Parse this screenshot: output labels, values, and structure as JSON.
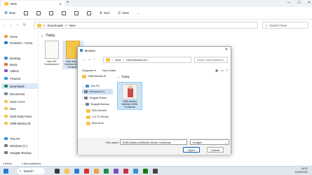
{
  "window": {
    "tab_title": "New"
  },
  "commands": {
    "new": "New",
    "sort": "Sort",
    "view": "View",
    "more": "..."
  },
  "address": {
    "parts": [
      "Downloads",
      "New"
    ],
    "sep": ">"
  },
  "search": {
    "placeholder": "Search New"
  },
  "sidebar": {
    "items": [
      {
        "label": "Home"
      },
      {
        "label": "OneDrive - Perso"
      },
      {
        "label": "Desktop"
      },
      {
        "label": "Music"
      },
      {
        "label": "Videos"
      },
      {
        "label": "Pictures"
      },
      {
        "label": "Downloads"
      },
      {
        "label": "Documents"
      },
      {
        "label": "2022-AAAA"
      },
      {
        "label": "New"
      },
      {
        "label": "2020-Dolly Parto"
      },
      {
        "label": "1998-Martina M"
      },
      {
        "label": "This PC"
      },
      {
        "label": "Windows (C:)"
      },
      {
        "label": "Seagate Backup"
      }
    ]
  },
  "content": {
    "group": "Today",
    "files": [
      {
        "line1": "New HP",
        "line2": "Screenshot 1"
      },
      {
        "line1": "1998-Martina",
        "line2": "McBride-White",
        "line3": "Christmas"
      }
    ]
  },
  "status": {
    "count": "2 items",
    "selected": "1 item selected"
  },
  "dialog": {
    "title": "Browse",
    "address": [
      "New",
      "1998-Martina Mc..."
    ],
    "search_placeholder": "Search 1998-Martina M...",
    "organize": "Organize ▾",
    "new_folder": "New folder",
    "tree": [
      {
        "label": "1998-Martina M"
      },
      {
        "label": "This PC"
      },
      {
        "label": "Windows (C:)"
      },
      {
        "label": "Seagate Backu"
      },
      {
        "label": "Seagate Backup"
      },
      {
        "label": "0001-Movies"
      },
      {
        "label": "1-A-TV Shows"
      },
      {
        "label": "Miss Docs"
      }
    ],
    "group": "Today",
    "file": {
      "line1": "1998-Martina",
      "line2": "McBride-White",
      "line3": "Christmas"
    },
    "filename_label": "File name:",
    "filename_value": "1998-Martina McBride-White Christmas",
    "filetype": "Images",
    "open": "Open",
    "cancel": "Cancel"
  },
  "taskbar": {
    "search": "Search",
    "time": "18:37",
    "date": "11/25/2022"
  },
  "colors": {
    "folder": "#f5c54c",
    "accent": "#0067c0",
    "selection": "#cce4f7"
  }
}
